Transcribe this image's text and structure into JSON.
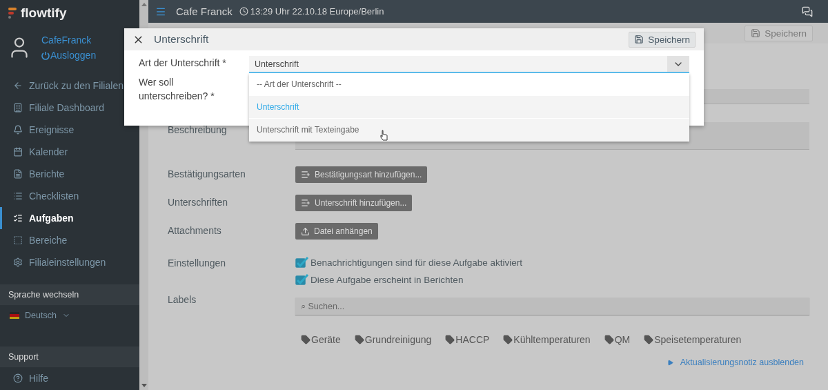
{
  "sidebar": {
    "logo": "flowtify",
    "user": {
      "name": "CafeFranck",
      "logout": "Ausloggen"
    },
    "nav": [
      {
        "label": "Zurück zu den Filialen",
        "selected": false
      },
      {
        "label": "Filiale Dashboard",
        "selected": false
      },
      {
        "label": "Ereignisse",
        "selected": false
      },
      {
        "label": "Kalender",
        "selected": false
      },
      {
        "label": "Berichte",
        "selected": false
      },
      {
        "label": "Checklisten",
        "selected": false
      },
      {
        "label": "Aufgaben",
        "selected": true
      },
      {
        "label": "Bereiche",
        "selected": false
      },
      {
        "label": "Filialeinstellungen",
        "selected": false
      }
    ],
    "language_header": "Sprache wechseln",
    "language": "Deutsch",
    "support_header": "Support",
    "support_items": [
      "Hilfe"
    ]
  },
  "topbar": {
    "title": "Cafe Franck",
    "time": "13:29 Uhr 22.10.18 Europe/Berlin"
  },
  "page": {
    "save_button": "Speichern",
    "description_label": "Beschreibung",
    "rows": [
      {
        "label": "Bestätigungsarten",
        "button": "Bestätigungsart hinzufügen...",
        "kind": "add"
      },
      {
        "label": "Unterschriften",
        "button": "Unterschrift hinzufügen...",
        "kind": "add"
      },
      {
        "label": "Attachments",
        "button": "Datei anhängen",
        "kind": "upload"
      }
    ],
    "settings_label": "Einstellungen",
    "settings": [
      {
        "label": "Benachrichtigungen sind für diese Aufgabe aktiviert",
        "checked": true
      },
      {
        "label": "Diese Aufgabe erscheint in Berichten",
        "checked": true
      }
    ],
    "labels_label": "Labels",
    "labels_search": {
      "placeholder": "⌕ Suchen..."
    },
    "tags": [
      "Geräte",
      "Grundreinigung",
      "HACCP",
      "Kühltemperaturen",
      "QM",
      "Speisetemperaturen"
    ],
    "toggle_link": "Aktualisierungsnotiz ausblenden"
  },
  "modal": {
    "title": "Unterschrift",
    "save_button": "Speichern",
    "type_label": "Art der Unterschrift *",
    "signer_label": "Wer soll unterschreiben? *",
    "select": {
      "value": "Unterschrift",
      "expanded": true,
      "options": [
        {
          "label": "-- Art der Unterschrift --",
          "selected": false
        },
        {
          "label": "Unterschrift",
          "selected": true
        },
        {
          "label": "Unterschrift mit Texteingabe",
          "selected": false
        }
      ]
    }
  }
}
